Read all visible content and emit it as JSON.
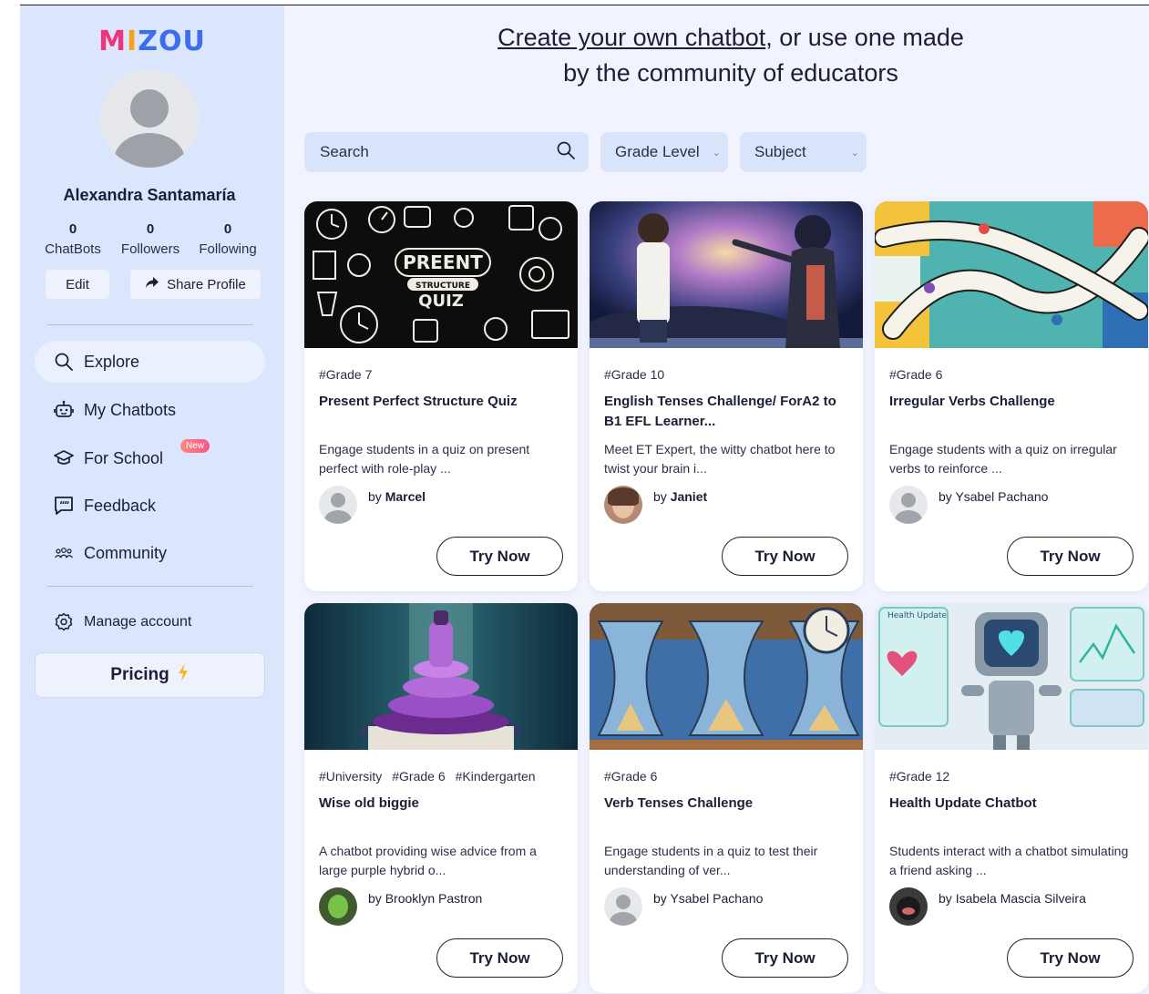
{
  "brand": {
    "logo_text": "MIZOU",
    "colors": {
      "M": "#f0347a",
      "I": "#f7a21d",
      "Z": "#3a6df0",
      "O": "#3a6df0",
      "U": "#3a6df0"
    }
  },
  "profile": {
    "name": "Alexandra Santamaría",
    "stats": [
      {
        "value": "0",
        "label": "ChatBots"
      },
      {
        "value": "0",
        "label": "Followers"
      },
      {
        "value": "0",
        "label": "Following"
      }
    ],
    "edit_label": "Edit",
    "share_label": "Share Profile"
  },
  "nav": {
    "explore": "Explore",
    "my_chatbots": "My Chatbots",
    "for_school": "For School",
    "new_badge": "New",
    "feedback": "Feedback",
    "community": "Community",
    "manage_account": "Manage account",
    "pricing": "Pricing"
  },
  "header": {
    "link_text": "Create your own chatbot",
    "rest_text": ", or use one made",
    "line2": "by the community of educators"
  },
  "filters": {
    "search_placeholder": "Search",
    "grade_level": "Grade Level",
    "subject": "Subject"
  },
  "cards": [
    {
      "tags": [
        "#Grade 7"
      ],
      "title": "Present Perfect Structure Quiz",
      "desc": "Engage students in a quiz on present perfect with role-play ...",
      "by_prefix": "by",
      "author": "Marcel",
      "author_bold": true,
      "try": "Try Now",
      "thumb_text": [
        "PREENT",
        "STRUCTURE",
        "QUIZ"
      ]
    },
    {
      "tags": [
        "#Grade 10"
      ],
      "title": "English Tenses Challenge/  ForA2 to B1 EFL Learner...",
      "desc": "Meet ET Expert, the witty chatbot here to twist your brain i...",
      "by_prefix": "by",
      "author": "Janiet",
      "author_bold": true,
      "try": "Try Now"
    },
    {
      "tags": [
        "#Grade 6"
      ],
      "title": "Irregular Verbs Challenge",
      "desc": "Engage students with a quiz on irregular verbs to reinforce ...",
      "by_prefix": "by",
      "author": "Ysabel Pachano",
      "author_bold": false,
      "try": "Try Now"
    },
    {
      "tags": [
        "#University",
        "#Grade 6",
        "#Kindergarten"
      ],
      "title": "Wise old biggie",
      "desc": "A chatbot providing wise advice from a large purple hybrid o...",
      "by_prefix": "by",
      "author": "Brooklyn Pastron",
      "author_bold": false,
      "try": "Try Now"
    },
    {
      "tags": [
        "#Grade 6"
      ],
      "title": "Verb Tenses Challenge",
      "desc": "Engage students in a quiz to test their understanding of ver...",
      "by_prefix": "by",
      "author": "Ysabel Pachano",
      "author_bold": false,
      "try": "Try Now"
    },
    {
      "tags": [
        "#Grade 12"
      ],
      "title": "Health Update Chatbot",
      "desc": "Students interact with a chatbot simulating a friend asking ...",
      "by_prefix": "by",
      "author": "Isabela Mascia Silveira",
      "author_bold": false,
      "try": "Try Now",
      "thumb_text": [
        "Health Update"
      ]
    }
  ]
}
